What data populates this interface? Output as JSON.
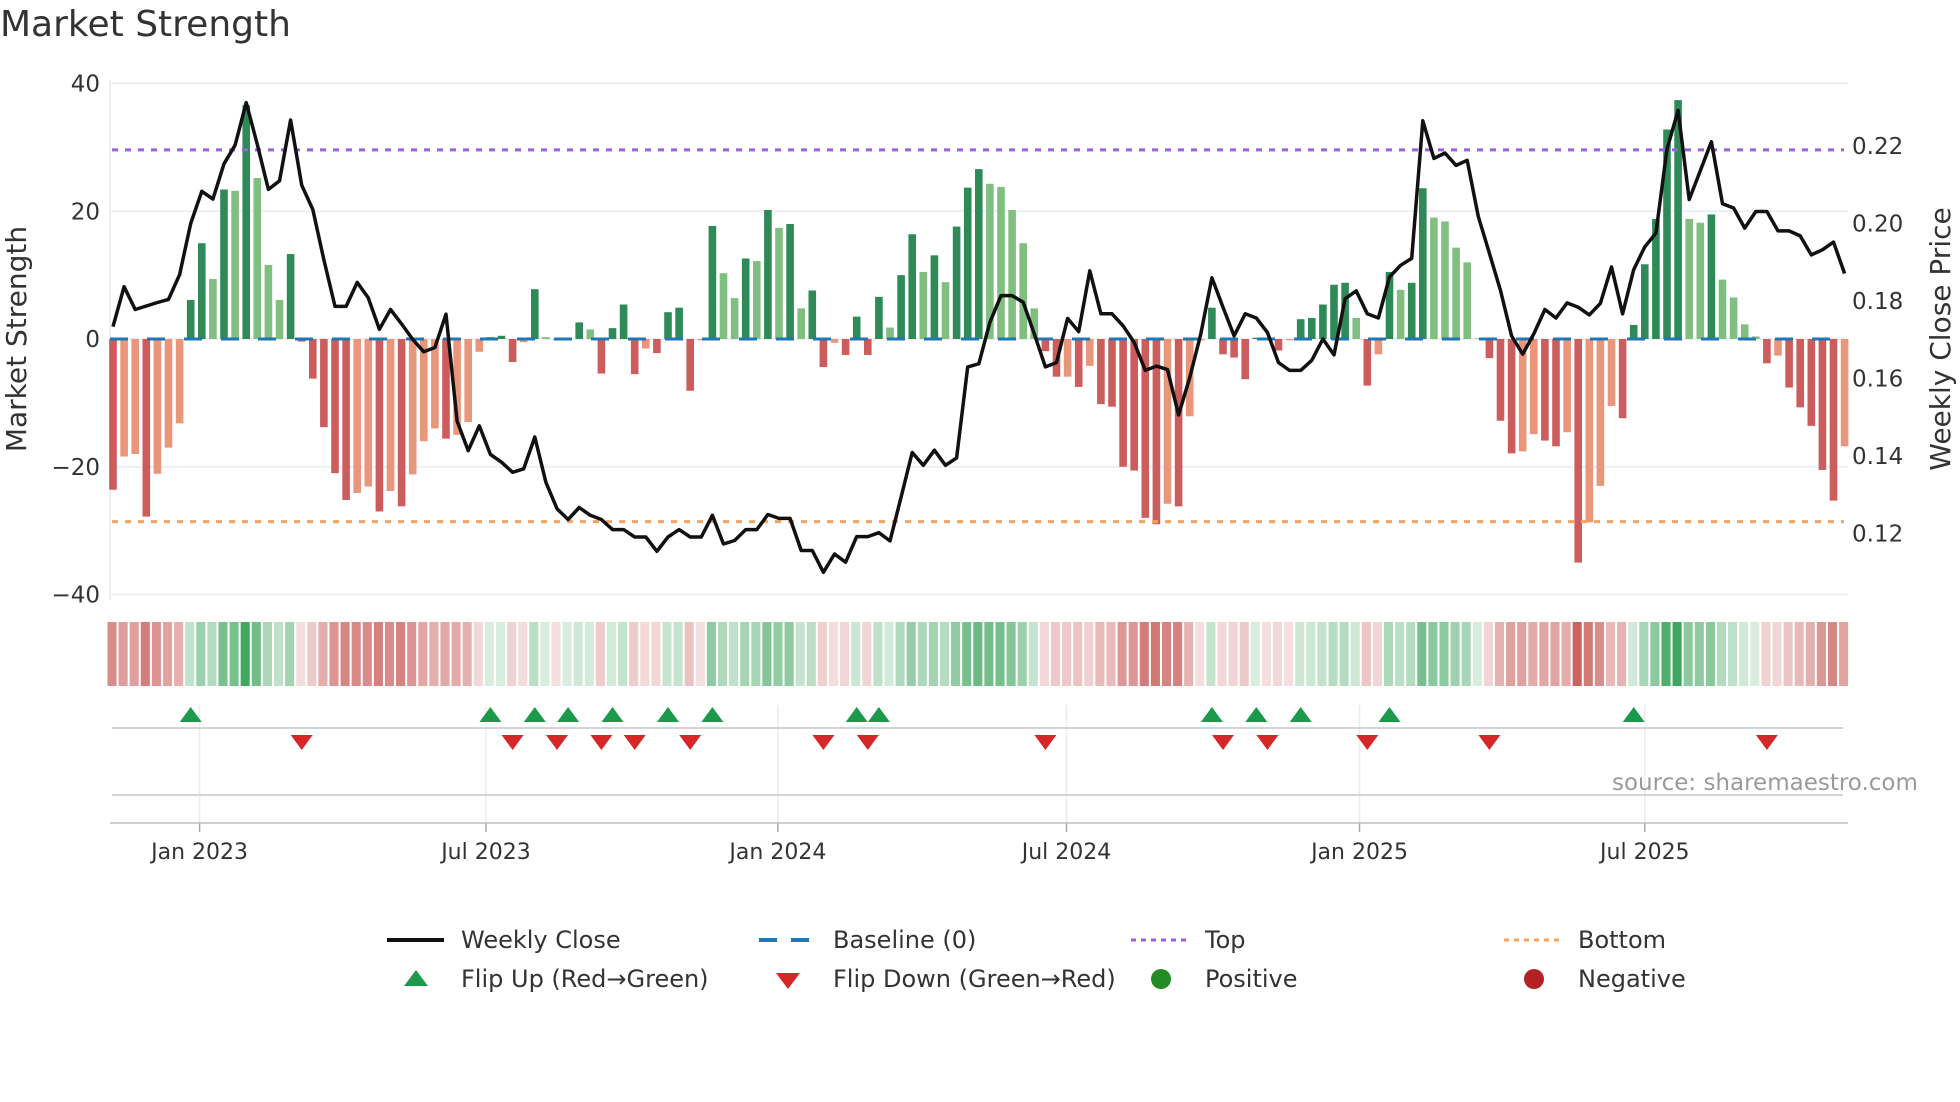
{
  "title": "Market Strength",
  "source": "source: sharemaestro.com",
  "colors": {
    "bar_pos_strong": "#2e8b57",
    "bar_pos_weak": "#80bf80",
    "bar_neg_strong": "#cd5c5c",
    "bar_neg_weak": "#e9967a",
    "close_line": "#111111",
    "baseline": "#1f77b4",
    "top": "#9b5fe0",
    "bottom": "#f4a460",
    "flip_up": "#1a9a4a",
    "flip_down": "#d62728",
    "positive": "#228b22",
    "negative": "#b22222",
    "strip_pos": "#2e9e50",
    "strip_neg": "#c44e4a"
  },
  "legend": {
    "weekly_close": "Weekly Close",
    "baseline": "Baseline (0)",
    "top": "Top",
    "bottom": "Bottom",
    "flip_up": "Flip Up (Red→Green)",
    "flip_down": "Flip Down (Green→Red)",
    "positive": "Positive",
    "negative": "Negative"
  },
  "chart_data": {
    "type": "bar",
    "title": "Market Strength",
    "ylabel": "Market Strength",
    "y2label": "Weekly Close Price",
    "ylim": [
      -40,
      40
    ],
    "y2lim": [
      0.1,
      0.232
    ],
    "yticks": [
      40,
      20,
      0,
      -20,
      -40
    ],
    "ytick_labels": [
      "40",
      "20",
      "0",
      "−20",
      "−40"
    ],
    "y2ticks": [
      0.22,
      0.2,
      0.18,
      0.16,
      0.14,
      0.12
    ],
    "y2tick_labels": [
      "0.22",
      "0.20",
      "0.18",
      "0.16",
      "0.14",
      "0.12"
    ],
    "xticks": [
      {
        "week_index": 7.8,
        "label": "Jan 2023"
      },
      {
        "week_index": 33.6,
        "label": "Jul 2023"
      },
      {
        "week_index": 59.9,
        "label": "Jan 2024"
      },
      {
        "week_index": 85.9,
        "label": "Jul 2024"
      },
      {
        "week_index": 112.3,
        "label": "Jan 2025"
      },
      {
        "week_index": 138.0,
        "label": "Jul 2025"
      }
    ],
    "grid": true,
    "legend_position": "bottom",
    "top_level": 29.6,
    "bottom_level": -28.6,
    "baseline_level": 0,
    "strength": [
      -23.6,
      -18.4,
      -18,
      -27.8,
      -21.1,
      -17,
      -13.2,
      6.1,
      15,
      9.4,
      23.4,
      23.2,
      36.6,
      25.2,
      11.6,
      6.1,
      13.3,
      -0.4,
      -6.2,
      -13.8,
      -21,
      -25.2,
      -24.1,
      -23.1,
      -27,
      -23.8,
      -26.2,
      -21.2,
      -16,
      -14,
      -15.6,
      -15,
      -13,
      -2,
      0.3,
      0.5,
      -3.6,
      -0.5,
      7.8,
      0.3,
      -0.1,
      0.1,
      2.6,
      1.5,
      -5.4,
      1.7,
      5.4,
      -5.5,
      -1.5,
      -2.2,
      4.2,
      4.9,
      -8.1,
      -0.2,
      17.7,
      10.3,
      6.4,
      12.6,
      12.2,
      20.2,
      17.4,
      18,
      4.8,
      7.6,
      -4.4,
      -0.6,
      -2.5,
      3.5,
      -2.5,
      6.6,
      1.8,
      10,
      16.4,
      10.5,
      13.1,
      8.9,
      17.6,
      23.7,
      26.6,
      24.3,
      23.8,
      20.2,
      15,
      4.8,
      -1.9,
      -5.9,
      -5.9,
      -7.5,
      -4.2,
      -10.2,
      -10.6,
      -20,
      -20.6,
      -28,
      -29,
      -25.8,
      -26.2,
      -12.1,
      -0.2,
      4.9,
      -2.4,
      -2.9,
      -6.3,
      0.2,
      -0.2,
      -1.8,
      -0.2,
      3.1,
      3.3,
      5.4,
      8.5,
      8.8,
      3.3,
      -7.3,
      -2.4,
      10.5,
      7.7,
      8.8,
      23.6,
      19,
      18.4,
      14.3,
      12,
      0.1,
      -3,
      -12.8,
      -17.9,
      -17.6,
      -14.9,
      -15.9,
      -16.8,
      -14.6,
      -35,
      -28.7,
      -23,
      -10.5,
      -12.4,
      2.2,
      11.7,
      18.8,
      32.8,
      37.4,
      18.8,
      18.2,
      19.5,
      9.3,
      6.5,
      2.3,
      0.4,
      -3.8,
      -2.6,
      -7.6,
      -10.7,
      -13.6,
      -20.5,
      -25.3,
      -16.8
    ],
    "weekly_close": [
      0.1734,
      0.1837,
      0.1778,
      0.1787,
      0.1796,
      0.1804,
      0.1868,
      0.2,
      0.2083,
      0.2063,
      0.2154,
      0.2202,
      0.2312,
      0.2204,
      0.2088,
      0.211,
      0.2267,
      0.2099,
      0.2036,
      0.1906,
      0.1786,
      0.1786,
      0.1848,
      0.1808,
      0.1727,
      0.1778,
      0.1741,
      0.1701,
      0.1669,
      0.168,
      0.1766,
      0.149,
      0.1414,
      0.1478,
      0.1404,
      0.1384,
      0.1358,
      0.1367,
      0.1449,
      0.1332,
      0.1264,
      0.1236,
      0.1267,
      0.1247,
      0.1236,
      0.121,
      0.121,
      0.1191,
      0.1191,
      0.1154,
      0.1191,
      0.121,
      0.1191,
      0.1191,
      0.1247,
      0.1173,
      0.1182,
      0.121,
      0.121,
      0.1249,
      0.1239,
      0.1239,
      0.1156,
      0.1156,
      0.11,
      0.1147,
      0.1126,
      0.1192,
      0.1192,
      0.1202,
      0.1181,
      0.1294,
      0.1409,
      0.1376,
      0.1415,
      0.1376,
      0.1395,
      0.163,
      0.1638,
      0.1745,
      0.1814,
      0.1814,
      0.1797,
      0.1715,
      0.163,
      0.1641,
      0.1755,
      0.1721,
      0.1878,
      0.1767,
      0.1767,
      0.1736,
      0.1693,
      0.1621,
      0.1632,
      0.1623,
      0.1506,
      0.1602,
      0.1715,
      0.186,
      0.1784,
      0.171,
      0.1767,
      0.1756,
      0.1719,
      0.1641,
      0.1621,
      0.1621,
      0.1647,
      0.1702,
      0.1661,
      0.1806,
      0.1826,
      0.1767,
      0.1756,
      0.1862,
      0.1892,
      0.191,
      0.2265,
      0.2168,
      0.2182,
      0.215,
      0.2163,
      0.2018,
      0.1923,
      0.1827,
      0.171,
      0.1663,
      0.1715,
      0.1778,
      0.1756,
      0.1795,
      0.1784,
      0.1764,
      0.1794,
      0.1888,
      0.1767,
      0.1881,
      0.194,
      0.1975,
      0.2192,
      0.2292,
      0.2062,
      0.2136,
      0.2211,
      0.2051,
      0.204,
      0.1988,
      0.2031,
      0.2031,
      0.1981,
      0.1981,
      0.1968,
      0.1919,
      0.1932,
      0.1952,
      0.1871
    ]
  }
}
